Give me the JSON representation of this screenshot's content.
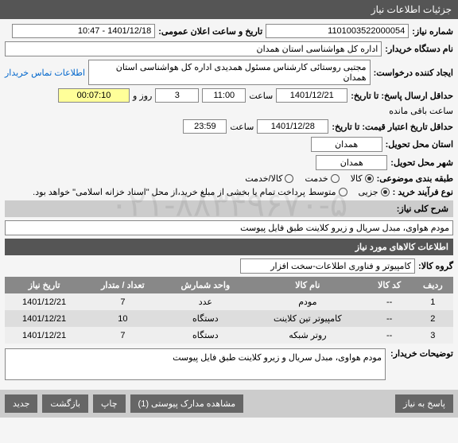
{
  "header": {
    "title": "جزئیات اطلاعات نیاز"
  },
  "fields": {
    "need_no_lbl": "شماره نیاز:",
    "need_no": "1101003522000054",
    "announce_lbl": "تاریخ و ساعت اعلان عمومی:",
    "announce": "1401/12/18 - 10:47",
    "buyer_org_lbl": "نام دستگاه خریدار:",
    "buyer_org": "اداره کل هواشناسی استان همدان",
    "requester_lbl": "ایجاد کننده درخواست:",
    "requester": "مجتبی روستائی کارشناس مسئول همدیدی اداره کل هواشناسی استان همدان",
    "contact_link": "اطلاعات تماس خریدار",
    "resp_deadline_lbl": "حداقل ارسال پاسخ: تا تاریخ:",
    "resp_date": "1401/12/21",
    "resp_time": "11:00",
    "day_lbl": "روز و",
    "days": "3",
    "countdown": "00:07:10",
    "remain_lbl": "ساعت باقی مانده",
    "valid_deadline_lbl": "حداقل تاریخ اعتبار قیمت: تا تاریخ:",
    "valid_date": "1401/12/28",
    "valid_time": "23:59",
    "time_lbl": "ساعت",
    "province_lbl": "استان محل تحویل:",
    "province": "همدان",
    "city_lbl": "شهر محل تحویل:",
    "city": "همدان",
    "class_lbl": "طبقه بندی موضوعی:",
    "buy_type_lbl": "نوع فرآیند خرید :",
    "class_opts": {
      "kala": "کالا",
      "khedmat": "خدمت",
      "kala_khedmat": "کالا/خدمت"
    },
    "buy_opts": {
      "jozi": "جزیی",
      "motevaset": "متوسط"
    },
    "buy_note": "پرداخت تمام یا بخشی از مبلغ خرید،از محل \"اسناد خزانه اسلامی\" خواهد بود."
  },
  "need_desc": {
    "section": "شرح کلی نیاز:",
    "text": "مودم هواوی، مبدل سریال و زیرو کلاینت طبق فایل پیوست"
  },
  "items": {
    "section": "اطلاعات کالاهای مورد نیاز",
    "group_lbl": "گروه کالا:",
    "group": "کامپیوتر و فناوری اطلاعات-سخت افزار",
    "cols": {
      "row": "ردیف",
      "code": "کد کالا",
      "name": "نام کالا",
      "unit": "واحد شمارش",
      "qty": "تعداد / متدار",
      "date": "تاریخ نیاز"
    },
    "rows": [
      {
        "row": "1",
        "code": "--",
        "name": "مودم",
        "unit": "عدد",
        "qty": "7",
        "date": "1401/12/21"
      },
      {
        "row": "2",
        "code": "--",
        "name": "کامپیوتر تین کلاینت",
        "unit": "دستگاه",
        "qty": "10",
        "date": "1401/12/21"
      },
      {
        "row": "3",
        "code": "--",
        "name": "روتر شبکه",
        "unit": "دستگاه",
        "qty": "7",
        "date": "1401/12/21"
      }
    ]
  },
  "buyer_desc": {
    "lbl": "توضیحات خریدار:",
    "text": "مودم هواوی، مبدل سریال و زیرو کلاینت طبق فایل پیوست"
  },
  "footer": {
    "respond": "پاسخ به نیاز",
    "attachments": "مشاهده مدارک پیوستی (1)",
    "print": "چاپ",
    "back": "بازگشت",
    "new": "جدید"
  },
  "watermark": "۰۲۱-۸۸۳۴۹۶۷۰-۵"
}
